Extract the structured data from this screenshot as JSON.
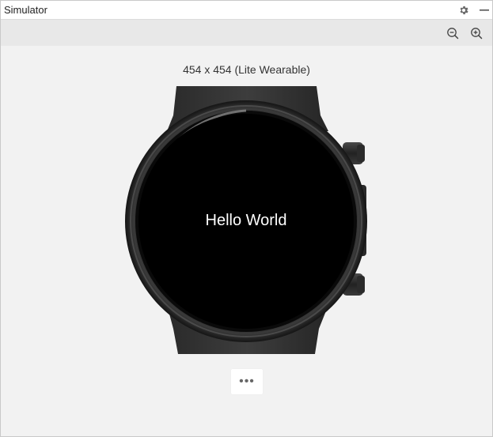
{
  "window": {
    "title": "Simulator"
  },
  "titlebar": {
    "settings_icon": "gear-icon",
    "minimize_icon": "minimize-icon"
  },
  "toolbar": {
    "zoom_out_icon": "zoom-out-icon",
    "zoom_in_icon": "zoom-in-icon"
  },
  "simulator": {
    "device_label": "454 x 454 (Lite Wearable)",
    "screen_text": "Hello World",
    "more_label": "•••"
  },
  "colors": {
    "accent": "#000000",
    "window_bg": "#f2f2f2",
    "toolbar_bg": "#e8e8e8"
  }
}
